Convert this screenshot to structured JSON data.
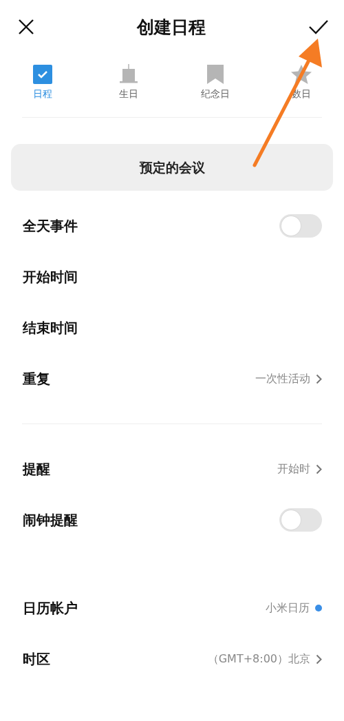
{
  "header": {
    "title": "创建日程"
  },
  "tabs": [
    {
      "kind": "event",
      "label": "日程",
      "selected": true
    },
    {
      "kind": "birthday",
      "label": "生日",
      "selected": false
    },
    {
      "kind": "anniversary",
      "label": "纪念日",
      "selected": false
    },
    {
      "kind": "countdown",
      "label": "数日",
      "selected": false
    }
  ],
  "title_field": {
    "placeholder": "预定的会议"
  },
  "groups": [
    [
      {
        "kind": "toggle",
        "label": "全天事件",
        "on": false
      },
      {
        "kind": "plain",
        "label": "开始时间"
      },
      {
        "kind": "plain",
        "label": "结束时间"
      },
      {
        "kind": "value",
        "label": "重复",
        "value": "一次性活动"
      }
    ],
    [
      {
        "kind": "value",
        "label": "提醒",
        "value": "开始时"
      },
      {
        "kind": "toggle",
        "label": "闹钟提醒",
        "on": false
      }
    ],
    [
      {
        "kind": "account",
        "label": "日历帐户",
        "value": "小米日历",
        "color": "#3a8ee6"
      },
      {
        "kind": "value",
        "label": "时区",
        "value": "（GMT+8:00）北京"
      }
    ]
  ]
}
